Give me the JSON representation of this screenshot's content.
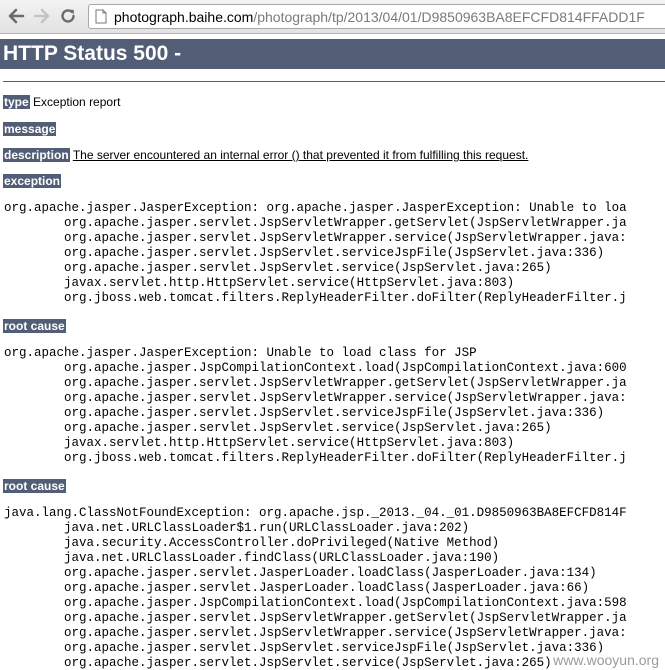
{
  "browser": {
    "url_host": "photograph.baihe.com",
    "url_path": "/photograph/tp/2013/04/01/D9850963BA8EFCFD814FFADD1F"
  },
  "page": {
    "title": "HTTP Status 500 -",
    "type_label": "type",
    "type_value": "Exception report",
    "message_label": "message",
    "description_label": "description",
    "description_value": "The server encountered an internal error () that prevented it from fulfilling this request.",
    "exception_label": "exception",
    "exception_trace": "org.apache.jasper.JasperException: org.apache.jasper.JasperException: Unable to loa\n\torg.apache.jasper.servlet.JspServletWrapper.getServlet(JspServletWrapper.ja\n\torg.apache.jasper.servlet.JspServletWrapper.service(JspServletWrapper.java:\n\torg.apache.jasper.servlet.JspServlet.serviceJspFile(JspServlet.java:336)\n\torg.apache.jasper.servlet.JspServlet.service(JspServlet.java:265)\n\tjavax.servlet.http.HttpServlet.service(HttpServlet.java:803)\n\torg.jboss.web.tomcat.filters.ReplyHeaderFilter.doFilter(ReplyHeaderFilter.j",
    "root_cause_1_label": "root cause",
    "root_cause_1_trace": "org.apache.jasper.JasperException: Unable to load class for JSP\n\torg.apache.jasper.JspCompilationContext.load(JspCompilationContext.java:600\n\torg.apache.jasper.servlet.JspServletWrapper.getServlet(JspServletWrapper.ja\n\torg.apache.jasper.servlet.JspServletWrapper.service(JspServletWrapper.java:\n\torg.apache.jasper.servlet.JspServlet.serviceJspFile(JspServlet.java:336)\n\torg.apache.jasper.servlet.JspServlet.service(JspServlet.java:265)\n\tjavax.servlet.http.HttpServlet.service(HttpServlet.java:803)\n\torg.jboss.web.tomcat.filters.ReplyHeaderFilter.doFilter(ReplyHeaderFilter.j",
    "root_cause_2_label": "root cause",
    "root_cause_2_trace": "java.lang.ClassNotFoundException: org.apache.jsp._2013._04._01.D9850963BA8EFCFD814F\n\tjava.net.URLClassLoader$1.run(URLClassLoader.java:202)\n\tjava.security.AccessController.doPrivileged(Native Method)\n\tjava.net.URLClassLoader.findClass(URLClassLoader.java:190)\n\torg.apache.jasper.servlet.JasperLoader.loadClass(JasperLoader.java:134)\n\torg.apache.jasper.servlet.JasperLoader.loadClass(JasperLoader.java:66)\n\torg.apache.jasper.JspCompilationContext.load(JspCompilationContext.java:598\n\torg.apache.jasper.servlet.JspServletWrapper.getServlet(JspServletWrapper.ja\n\torg.apache.jasper.servlet.JspServletWrapper.service(JspServletWrapper.java:\n\torg.apache.jasper.servlet.JspServlet.serviceJspFile(JspServlet.java:336)\n\torg.apache.jasper.servlet.JspServlet.service(JspServlet.java:265)"
  },
  "watermark": "www.wooyun.org",
  "colors": {
    "header_bg": "#525d76",
    "header_text": "#ffffff"
  }
}
